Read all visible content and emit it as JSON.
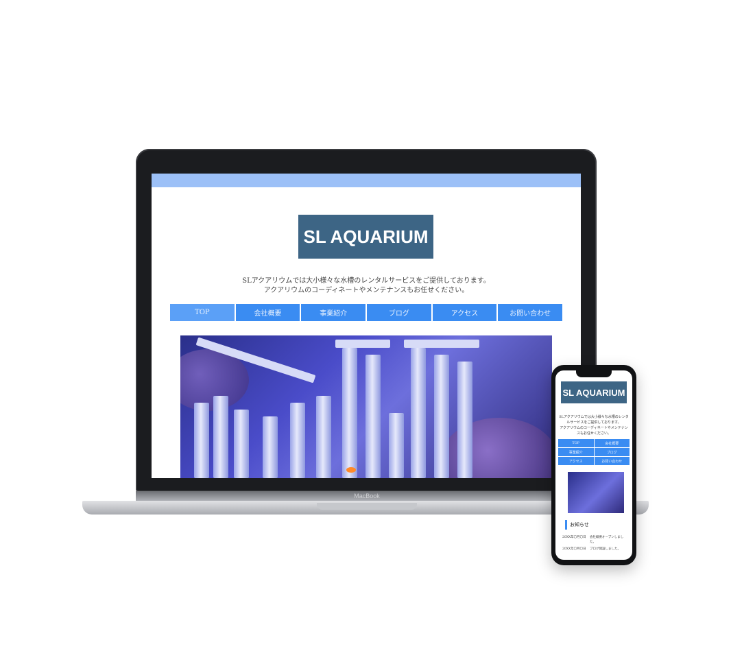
{
  "site": {
    "logo_text": "SL AQUARIUM",
    "intro_line1": "SLアクアリウムでは大小様々な水槽のレンタルサービスをご提供しております。",
    "intro_line2": "アクアリウムのコーディネートやメンテナンスもお任せください。",
    "nav": [
      "TOP",
      "会社概要",
      "事業紹介",
      "ブログ",
      "アクセス",
      "お問い合わせ"
    ],
    "news_title": "お知らせ",
    "news": [
      {
        "date": "20XX年〇月〇日",
        "text": "会社概要オープンしました。"
      },
      {
        "date": "20XX年〇月〇日",
        "text": "ブログ開設しました。"
      }
    ]
  },
  "device": {
    "laptop_brand": "MacBook"
  },
  "colors": {
    "logo_bg": "#3d6585",
    "nav_bg": "#3a8cf2",
    "top_strip": "#9cc0f7"
  }
}
